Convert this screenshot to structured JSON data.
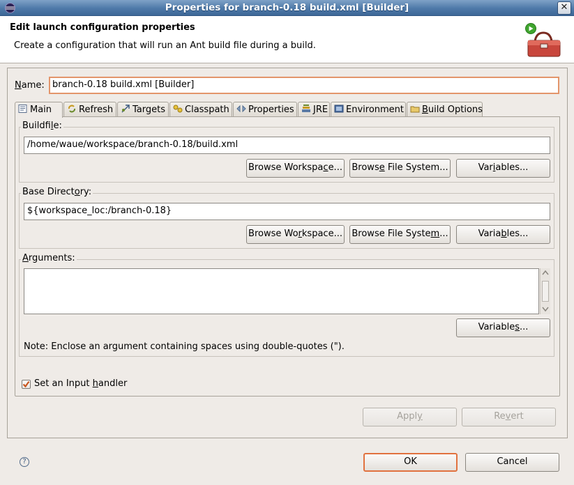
{
  "window": {
    "title": "Properties for branch-0.18 build.xml [Builder]",
    "close_glyph": "✕"
  },
  "header": {
    "title": "Edit launch configuration properties",
    "description": "Create a configuration that will run an Ant build file during a build."
  },
  "name_field": {
    "label_prefix": "",
    "label_mnemonic": "N",
    "label_rest": "ame:",
    "value": "branch-0.18 build.xml [Builder]"
  },
  "tabs": [
    {
      "label": "Main",
      "icon": "main-tab-icon",
      "active": true
    },
    {
      "label": "Refresh",
      "icon": "refresh-icon"
    },
    {
      "label": "Targets",
      "icon": "targets-icon"
    },
    {
      "label": "Classpath",
      "icon": "classpath-icon"
    },
    {
      "label": "Properties",
      "icon": "properties-icon"
    },
    {
      "label": "JRE",
      "icon": "jre-icon"
    },
    {
      "label": "Environment",
      "icon": "environment-icon"
    },
    {
      "label_mnemonic": "B",
      "label_rest": "uild Options",
      "icon": "build-options-icon"
    }
  ],
  "buildfile": {
    "label_prefix": "Buildfi",
    "label_mnemonic": "l",
    "label_suffix": "e:",
    "value": "/home/waue/workspace/branch-0.18/build.xml",
    "browse_workspace": {
      "prefix": "Browse Workspa",
      "mnemonic": "c",
      "suffix": "e..."
    },
    "browse_fs": {
      "prefix": "Brows",
      "mnemonic": "e",
      "suffix": " File System..."
    },
    "variables": {
      "prefix": "Var",
      "mnemonic": "i",
      "suffix": "ables..."
    }
  },
  "base_directory": {
    "label_prefix": "Base Direct",
    "label_mnemonic": "o",
    "label_suffix": "ry:",
    "value": "${workspace_loc:/branch-0.18}",
    "browse_workspace": {
      "prefix": "Browse Wo",
      "mnemonic": "r",
      "suffix": "kspace..."
    },
    "browse_fs": {
      "prefix": "Browse File Syste",
      "mnemonic": "m",
      "suffix": "..."
    },
    "variables": {
      "prefix": "Varia",
      "mnemonic": "b",
      "suffix": "les..."
    }
  },
  "arguments": {
    "label_mnemonic": "A",
    "label_rest": "rguments:",
    "value": "",
    "variables": {
      "prefix": "Variable",
      "mnemonic": "s",
      "suffix": "..."
    },
    "note": "Note: Enclose an argument containing spaces using double-quotes (\")."
  },
  "input_handler": {
    "checked": true,
    "label_prefix": "Set an Input ",
    "label_mnemonic": "h",
    "label_suffix": "andler"
  },
  "actions": {
    "apply": {
      "prefix": "Appl",
      "mnemonic": "y",
      "suffix": ""
    },
    "revert": {
      "prefix": "Re",
      "mnemonic": "v",
      "suffix": "ert"
    }
  },
  "footer": {
    "ok": "OK",
    "cancel": "Cancel",
    "help_glyph": "?"
  },
  "colors": {
    "title_bar": "#4e79a8",
    "default_button_border": "#e1723f",
    "checkbox_check": "#c8561f"
  }
}
